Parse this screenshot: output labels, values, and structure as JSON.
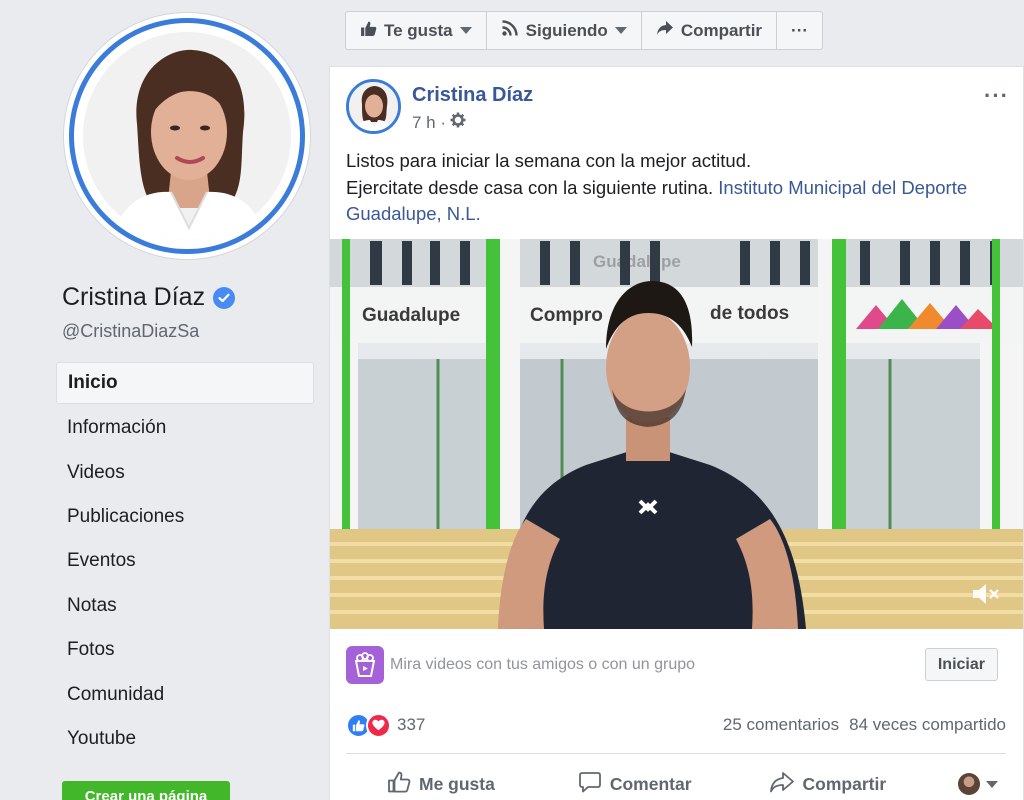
{
  "sidebar": {
    "name": "Cristina Díaz",
    "handle": "@CristinaDiazSa",
    "nav": [
      "Inicio",
      "Información",
      "Videos",
      "Publicaciones",
      "Eventos",
      "Notas",
      "Fotos",
      "Comunidad",
      "Youtube"
    ],
    "active_index": 0,
    "create_page": "Crear una página"
  },
  "actionbar": {
    "like": "Te gusta",
    "follow": "Siguiendo",
    "share": "Compartir",
    "more": "···"
  },
  "post": {
    "author": "Cristina Díaz",
    "time": "7 h ·",
    "more": "···",
    "line1": "Listos para iniciar la semana con la mejor actitud.",
    "line2": "Ejercitate desde casa con la siguiente rutina.",
    "link": "Instituto Municipal del Deporte Guadalupe, N.L.",
    "video": {
      "sign_left": "Guadalupe",
      "sign_mid": "Compro",
      "sign_right": "de todos",
      "sign_top": "Guadalupe"
    },
    "watch_prompt": "Mira videos con tus amigos o con un grupo",
    "watch_button": "Iniciar",
    "reactions_count": "337",
    "comments": "25 comentarios",
    "shares": "84 veces compartido",
    "action_like": "Me gusta",
    "action_comment": "Comentar",
    "action_share": "Compartir"
  },
  "colors": {
    "brand_blue": "#385898",
    "verified_blue": "#4a8af4",
    "ring_blue": "#3b7cdb",
    "create_green": "#42b72a",
    "watch_purple": "#a461d8"
  },
  "icons": [
    "verified-badge-icon",
    "thumbs-up-icon",
    "rss-icon",
    "share-arrow-icon",
    "gear-icon",
    "mute-icon",
    "popcorn-icon",
    "like-reaction-icon",
    "love-reaction-icon",
    "comment-icon",
    "caret-down-icon"
  ]
}
